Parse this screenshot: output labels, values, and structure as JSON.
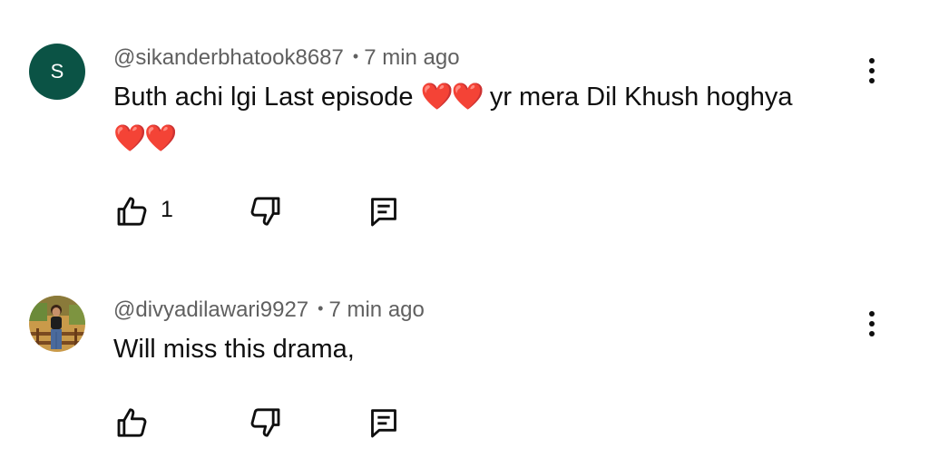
{
  "comments": [
    {
      "avatar_letter": "S",
      "avatar_color": "#0b5345",
      "handle": "@sikanderbhatook8687",
      "separator": "•",
      "time": "7 min ago",
      "text_line1": "Buth achi lgi Last episode",
      "hearts_inline": "❤️❤️",
      "text_line1_tail": " yr mera Dil Khush hoghya",
      "hearts_line2": "❤️❤️",
      "like_count": "1",
      "more_icon": "more-vert-icon",
      "like_icon": "thumbs-up-icon",
      "dislike_icon": "thumbs-down-icon",
      "reply_icon": "reply-comment-icon"
    },
    {
      "avatar_type": "photo",
      "handle": "@divyadilawari9927",
      "separator": "•",
      "time": "7 min ago",
      "text": "Will miss this drama,",
      "more_icon": "more-vert-icon",
      "like_icon": "thumbs-up-icon",
      "dislike_icon": "thumbs-down-icon",
      "reply_icon": "reply-comment-icon"
    }
  ],
  "colors": {
    "text_primary": "#0f0f0f",
    "text_secondary": "#606060",
    "heart": "#e0242a"
  }
}
